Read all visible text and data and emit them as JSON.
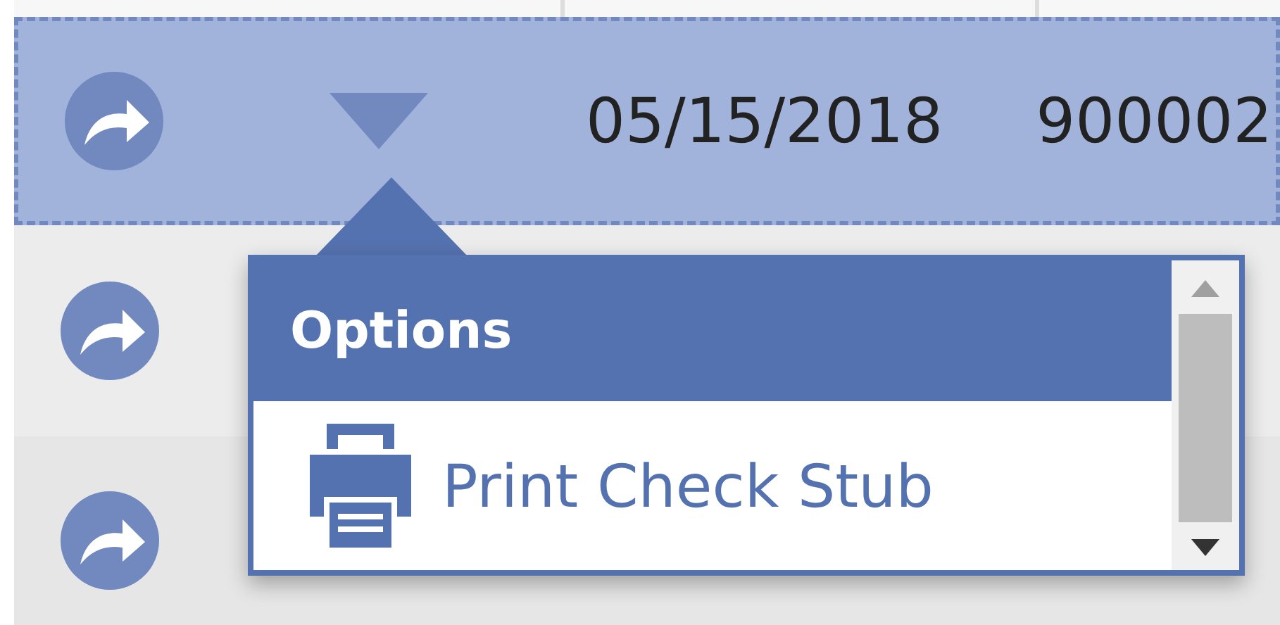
{
  "rows": [
    {
      "selected": true,
      "date": "05/15/2018",
      "number": "900002"
    },
    {
      "selected": false
    },
    {
      "selected": false
    }
  ],
  "popup": {
    "title": "Options",
    "items": [
      {
        "label": "Print Check Stub"
      }
    ]
  }
}
